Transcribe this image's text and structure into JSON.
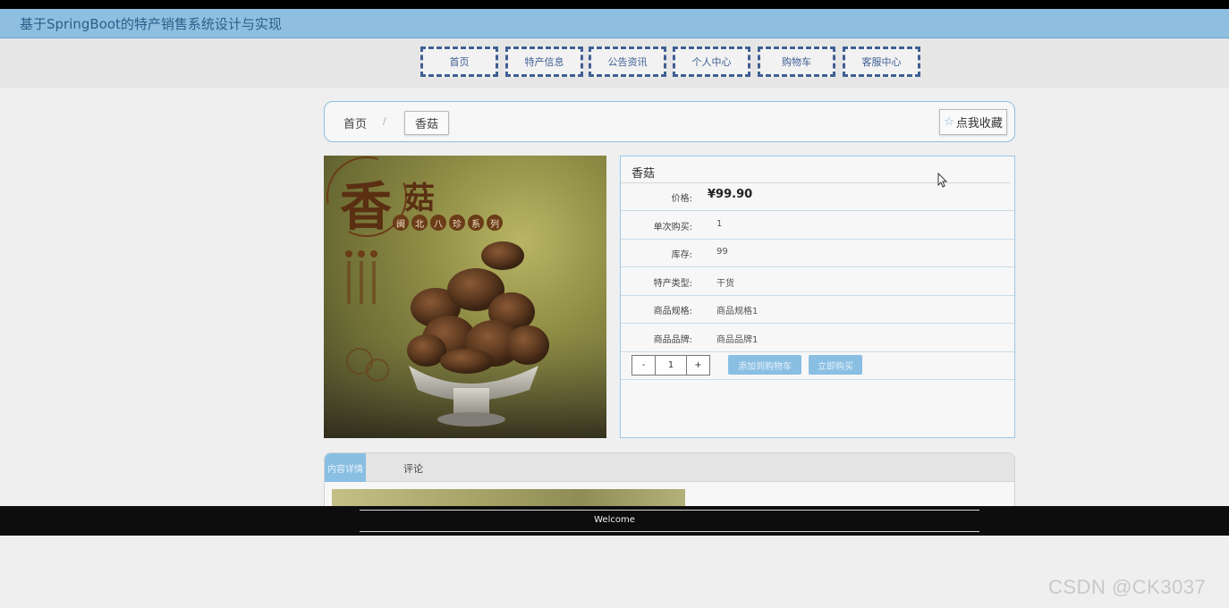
{
  "app": {
    "title": "基于SpringBoot的特产销售系统设计与实现"
  },
  "nav": {
    "items": [
      {
        "label": "首页"
      },
      {
        "label": "特产信息"
      },
      {
        "label": "公告资讯"
      },
      {
        "label": "个人中心"
      },
      {
        "label": "购物车"
      },
      {
        "label": "客服中心"
      }
    ]
  },
  "breadcrumb": {
    "home": "首页",
    "separator": "/",
    "current": "香菇"
  },
  "favorite": {
    "label": "点我收藏",
    "icon": "star-icon"
  },
  "product": {
    "image_title": "香",
    "image_title2": "菇",
    "image_series": [
      "闽",
      "北",
      "八",
      "珍",
      "系",
      "列"
    ],
    "name": "香菇",
    "price_label": "价格:",
    "price": "¥99.90",
    "fields": [
      {
        "label": "单次购买:",
        "value": "1"
      },
      {
        "label": "库存:",
        "value": "99"
      },
      {
        "label": "特产类型:",
        "value": "干货"
      },
      {
        "label": "商品规格:",
        "value": "商品规格1"
      },
      {
        "label": "商品品牌:",
        "value": "商品品牌1"
      }
    ]
  },
  "purchase": {
    "minus": "-",
    "quantity": "1",
    "plus": "+",
    "add_to_cart": "添加到购物车",
    "buy_now": "立即购买"
  },
  "tabs": {
    "detail": "内容详情",
    "comment": "评论"
  },
  "footer": {
    "text": "Welcome"
  },
  "watermark": "CSDN @CK3037",
  "colors": {
    "accent": "#8fbfe0",
    "nav_border": "#3f5f94",
    "button": "#89bfe3"
  }
}
